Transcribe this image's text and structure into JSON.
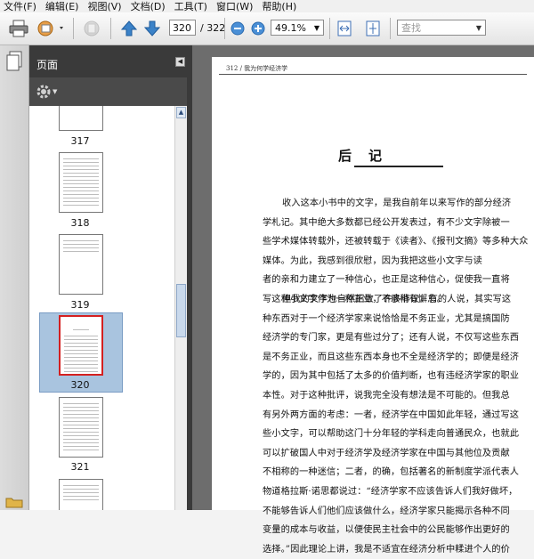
{
  "menu": [
    "文件(F)",
    "编辑(E)",
    "视图(V)",
    "文档(D)",
    "工具(T)",
    "窗口(W)",
    "帮助(H)"
  ],
  "toolbar": {
    "current_page": "320",
    "page_total": "/ 322",
    "zoom": "49.1%",
    "search_placeholder": "查找"
  },
  "panel": {
    "title": "页面",
    "thumbnails": [
      {
        "label": "317"
      },
      {
        "label": "318"
      },
      {
        "label": "319"
      },
      {
        "label": "320",
        "selected": true
      },
      {
        "label": "321"
      }
    ]
  },
  "document": {
    "header": "312 / 我为何学经济学",
    "heading": "后　记",
    "paragraph1": [
      "收入这本小书中的文字，是我自前年以来写作的部分经济",
      "学札记。其中绝大多数都已经公开发表过，有不少文字除被一",
      "些学术媒体转载外，还被转载于《读者》、《报刊文摘》等多种大众",
      "媒体。为此，我感到很欣慰，因为我把这些小文字与读",
      "者的亲和力建立了一种信心，也正是这种信心，促使我一直将",
      "写这种小文字作为一种正业，不敢稍有懈怠。"
    ],
    "paragraph2": [
      "但我的文字也自然招致了许多非议。有的人说，其实写这",
      "种东西对于一个经济学家来说恰恰是不务正业，尤其是搞国防",
      "经济学的专门家，更是有些过分了；还有人说，不仅写这些东西",
      "是不务正业，而且这些东西本身也不全是经济学的；即便是经济",
      "学的，因为其中包括了太多的价值判断，也有违经济学家的职业",
      "本性。对于这种批评，说我完全没有想法是不可能的。但我总",
      "有另外两方面的考虑：一者，经济学在中国如此年轻，通过写这",
      "些小文字，可以帮助这门十分年轻的学科走向普通民众，也就此",
      "可以扩破国人中对于经济学及经济学家在中国与其他位及贡献",
      "不相称的一种迷信；二者，的确，包括著名的新制度学派代表人",
      "物道格拉斯·诺思都说过：“经济学家不应该告诉人们我好做坏，",
      "不能够告诉人们他们应该做什么，经济学家只能揭示各种不同",
      "变量的成本与收益，以便使民主社会中的公民能够作出更好的",
      "选择。”因此理论上讲，我是不适宜在经济分析中糅进个人的价"
    ]
  }
}
